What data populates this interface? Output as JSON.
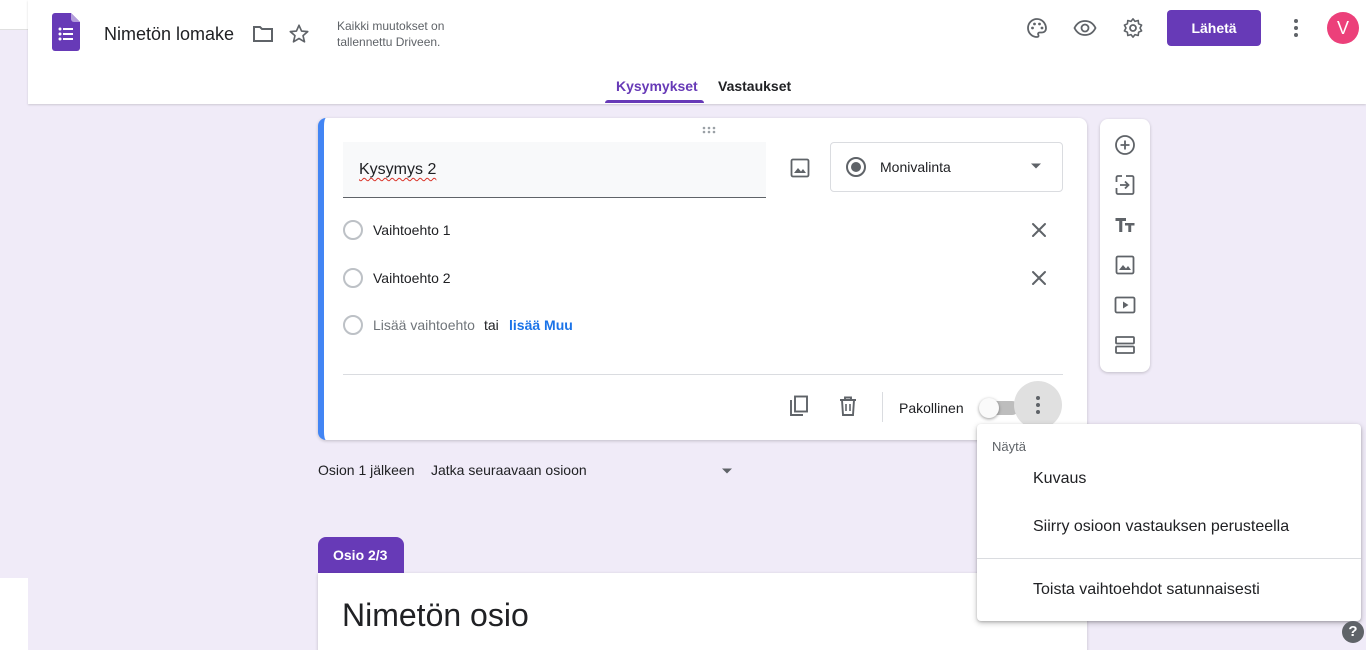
{
  "header": {
    "form_title": "Nimetön lomake",
    "save_status_line1": "Kaikki muutokset on",
    "save_status_line2": "tallennettu Driveen.",
    "send_label": "Lähetä",
    "avatar_initial": "V"
  },
  "tabs": [
    {
      "label": "Kysymykset",
      "active": true
    },
    {
      "label": "Vastaukset",
      "active": false
    }
  ],
  "question": {
    "title": "Kysymys 2",
    "type": "Monivalinta",
    "options": [
      "Vaihtoehto 1",
      "Vaihtoehto 2"
    ],
    "add_option": "Lisää vaihtoehto",
    "or_text": "tai",
    "add_other": "lisää Muu",
    "required_label": "Pakollinen",
    "required": false
  },
  "navigation": {
    "after_section_label": "Osion 1 jälkeen",
    "after_section_value": "Jatka seuraavaan osioon"
  },
  "section": {
    "tab_label": "Osio 2/3",
    "title": "Nimetön osio"
  },
  "menu": {
    "heading": "Näytä",
    "items": [
      "Kuvaus",
      "Siirry osioon vastauksen perusteella",
      "Toista vaihtoehdot satunnaisesti"
    ]
  },
  "help": {
    "label": "?"
  },
  "colors": {
    "accent": "#673ab7",
    "question_border": "#4285f4",
    "background": "#f0ebf8",
    "link": "#1a73e8",
    "avatar": "#ec407a"
  }
}
